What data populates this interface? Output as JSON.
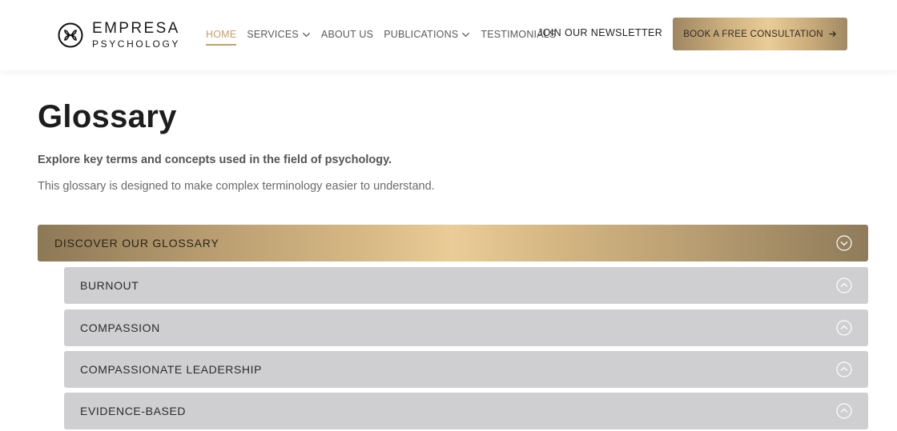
{
  "header": {
    "logo": {
      "name": "EMPRESA",
      "tagline": "PSYCHOLOGY",
      "icon": "empresa-logo-icon"
    },
    "nav": [
      {
        "label": "HOME",
        "active": true,
        "dropdown": false
      },
      {
        "label": "SERVICES",
        "active": false,
        "dropdown": true
      },
      {
        "label": "ABOUT US",
        "active": false,
        "dropdown": false
      },
      {
        "label": "PUBLICATIONS",
        "active": false,
        "dropdown": true
      },
      {
        "label": "TESTIMONIALS",
        "active": false,
        "dropdown": false
      }
    ],
    "newsletter_label": "JOIN OUR NEWSLETTER",
    "cta_label": "BOOK A FREE CONSULTATION",
    "cta_icon": "arrow-right-icon"
  },
  "main": {
    "title": "Glossary",
    "subtitle": "Explore key terms and concepts used in the field of psychology.",
    "description": "This glossary is designed to make complex terminology easier to understand.",
    "glossary": {
      "header_label": "DISCOVER OUR GLOSSARY",
      "header_icon": "chevron-down-circle-icon",
      "terms": [
        {
          "label": "BURNOUT",
          "icon": "chevron-up-circle-icon"
        },
        {
          "label": "COMPASSION",
          "icon": "chevron-up-circle-icon"
        },
        {
          "label": "COMPASSIONATE LEADERSHIP",
          "icon": "chevron-up-circle-icon"
        },
        {
          "label": "EVIDENCE-BASED",
          "icon": "chevron-up-circle-icon"
        }
      ]
    }
  },
  "colors": {
    "accent_gold": "#c29f6f",
    "term_background": "#cfcfd1",
    "text_dark": "#1d1d1d"
  }
}
